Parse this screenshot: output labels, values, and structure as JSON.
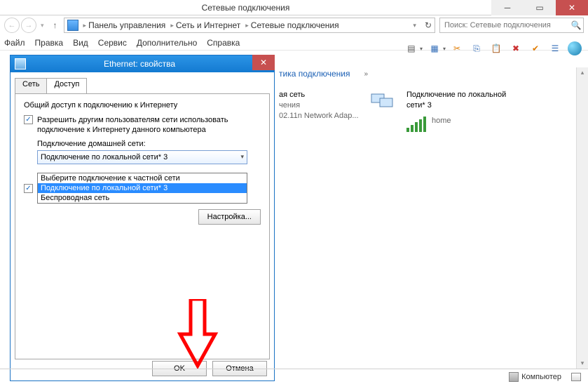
{
  "window": {
    "title": "Сетевые подключения"
  },
  "address": {
    "crumbs": [
      "Панель управления",
      "Сеть и Интернет",
      "Сетевые подключения"
    ],
    "search_placeholder": "Поиск: Сетевые подключения"
  },
  "menu": {
    "file": "Файл",
    "edit": "Правка",
    "view": "Вид",
    "service": "Сервис",
    "extra": "Дополнительно",
    "help": "Справка"
  },
  "commandbar": {
    "diag": "тика подключения"
  },
  "connections": {
    "item1": {
      "line1": "ая сеть",
      "line2": "чения",
      "line3": "02.11n Network Adap..."
    },
    "item2": {
      "line1": "Подключение по локальной",
      "line2": "сети* 3",
      "line3": "home"
    }
  },
  "dialog": {
    "title": "Ethernet: свойства",
    "tabs": {
      "net": "Сеть",
      "access": "Доступ"
    },
    "group": "Общий доступ к подключению к Интернету",
    "allow_label": "Разрешить другим пользователям сети использовать подключение к Интернету данного компьютера",
    "home_label": "Подключение домашней сети:",
    "select_value": "Подключение по локальной сети* 3",
    "options": {
      "o1": "Выберите подключение к частной сети",
      "o2": "Подключение по локальной сети* 3",
      "o3": "Беспроводная сеть"
    },
    "settings_btn": "Настройка...",
    "ok": "OK",
    "cancel": "Отмена"
  },
  "status": {
    "computer": "Компьютер"
  }
}
